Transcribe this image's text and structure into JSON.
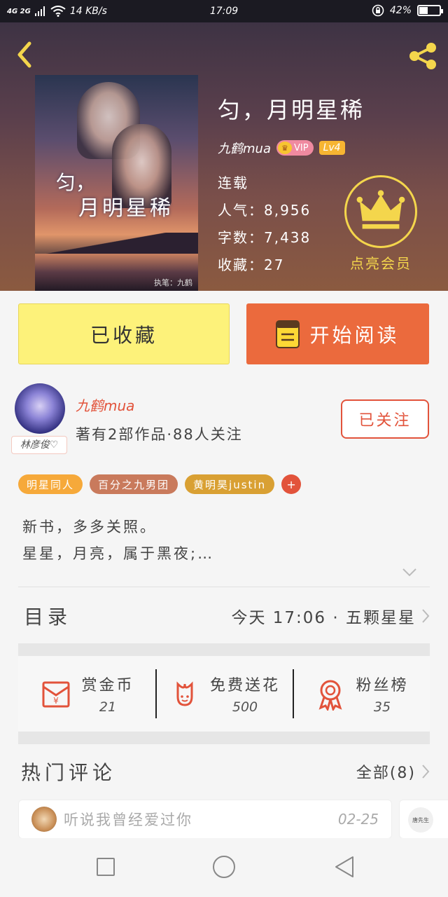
{
  "status_bar": {
    "network": "4G 2G",
    "speed": "14 KB/s",
    "time": "17:09",
    "battery": "42%",
    "battery_level": 0.42
  },
  "book": {
    "title": "匀，月明星稀",
    "cover_title_line1": "匀，",
    "cover_title_line2": "月明星稀",
    "cover_credit": "执笔：九鹤",
    "author": "九鹤mua",
    "vip_label": "VIP",
    "level": "Lv4",
    "status": "连载",
    "popularity_label": "人气：",
    "popularity": "8,956",
    "words_label": "字数：",
    "words": "7,438",
    "favorites_label": "收藏：",
    "favorites": "27"
  },
  "member": {
    "label": "点亮会员"
  },
  "actions": {
    "collected": "已收藏",
    "start_reading": "开始阅读"
  },
  "author_card": {
    "avatar_tag": "林彦俊♡",
    "name": "九鹤mua",
    "info": "著有2部作品·88人关注",
    "follow": "已关注"
  },
  "tags": [
    {
      "label": "明星同人",
      "color": "#f6a93a"
    },
    {
      "label": "百分之九男团",
      "color": "#c97a5c"
    },
    {
      "label": "黄明昊justin",
      "color": "#d9a033"
    }
  ],
  "tag_add": "+",
  "description": {
    "line1": "新书，多多关照。",
    "line2": "星星，月亮，属于黑夜;…"
  },
  "toc": {
    "title": "目录",
    "latest": "今天 17:06 · 五颗星星"
  },
  "stats": [
    {
      "label": "赏金币",
      "value": "21",
      "icon": "red-envelope-icon"
    },
    {
      "label": "免费送花",
      "value": "500",
      "icon": "flower-icon"
    },
    {
      "label": "粉丝榜",
      "value": "35",
      "icon": "ribbon-medal-icon"
    }
  ],
  "comments": {
    "title": "热门评论",
    "all": "全部(8)",
    "first": {
      "text": "听说我曾经爱过你",
      "date": "02-25"
    },
    "second_avatar_text": "唐先生"
  },
  "colors": {
    "accent": "#eb6a3d",
    "collected_bg": "#fdf27a",
    "gold": "#f4d64c",
    "red": "#e2533b"
  }
}
